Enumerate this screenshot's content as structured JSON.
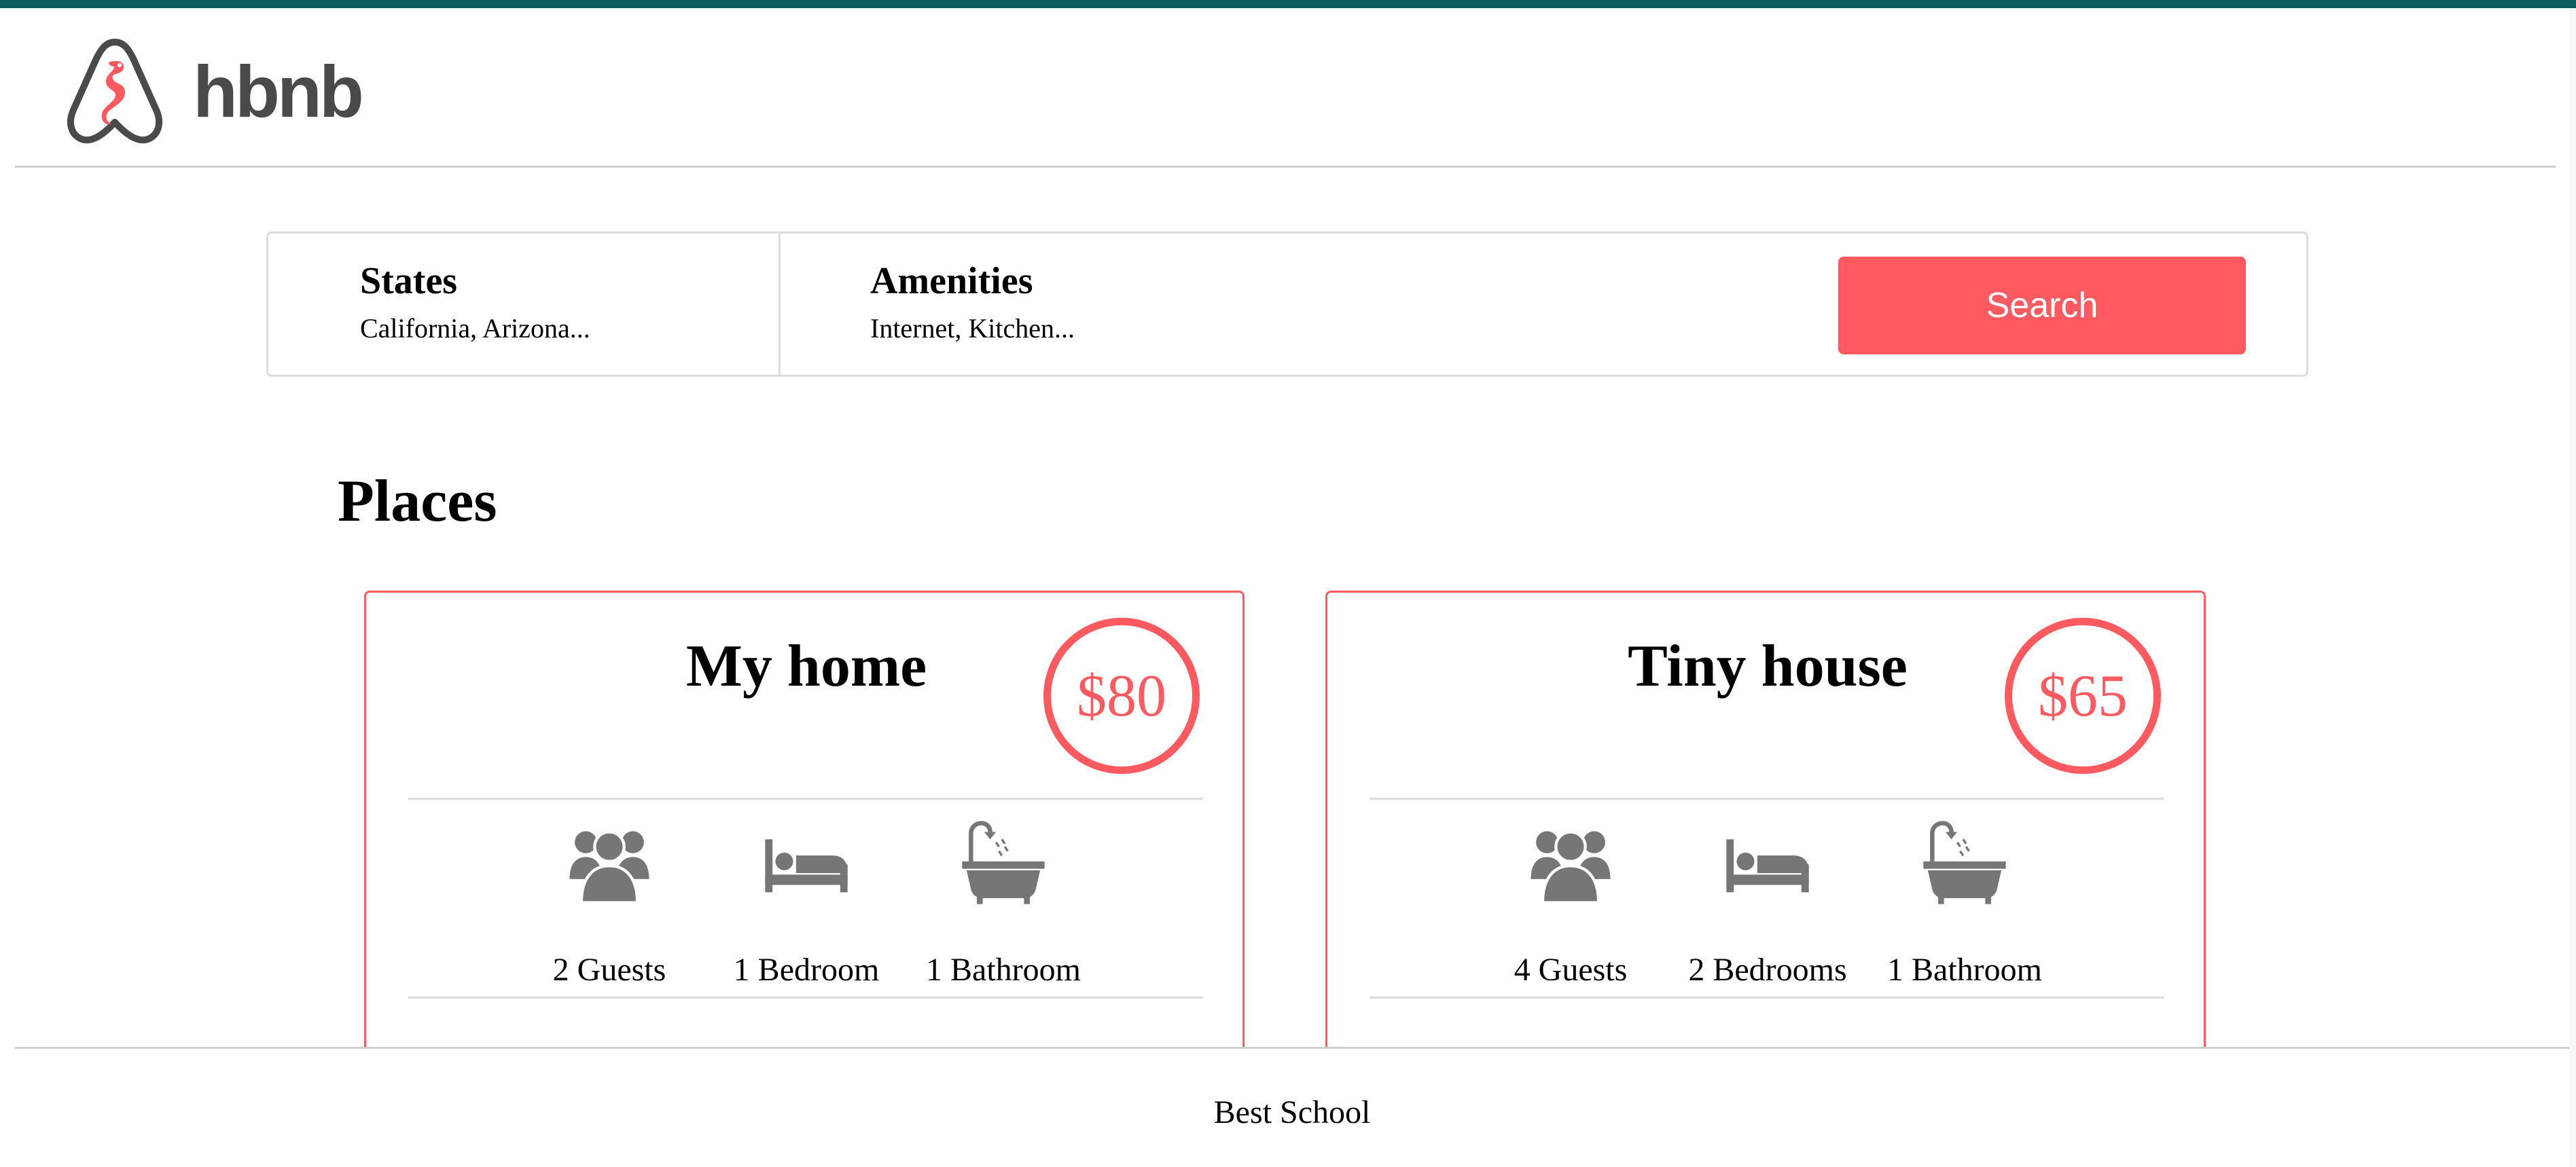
{
  "theme": {
    "accent": "#ff5a60",
    "topbar": "#0c5f5e",
    "icon_gray": "#767676"
  },
  "header": {
    "logo_text": "hbnb",
    "logo_icon": "airbnb-seahorse-logo-icon"
  },
  "filters": {
    "states": {
      "title": "States",
      "selected": "California, Arizona..."
    },
    "amenities": {
      "title": "Amenities",
      "selected": "Internet, Kitchen..."
    },
    "search_label": "Search"
  },
  "places": {
    "title": "Places",
    "items": [
      {
        "name": "My home",
        "price": "$80",
        "guests": "2 Guests",
        "bedrooms": "1 Bedroom",
        "bathrooms": "1 Bathroom"
      },
      {
        "name": "Tiny house",
        "price": "$65",
        "guests": "4 Guests",
        "bedrooms": "2 Bedrooms",
        "bathrooms": "1 Bathroom"
      }
    ],
    "icons": [
      "guests-icon",
      "bed-icon",
      "bathtub-icon"
    ]
  },
  "footer": {
    "text": "Best School"
  }
}
